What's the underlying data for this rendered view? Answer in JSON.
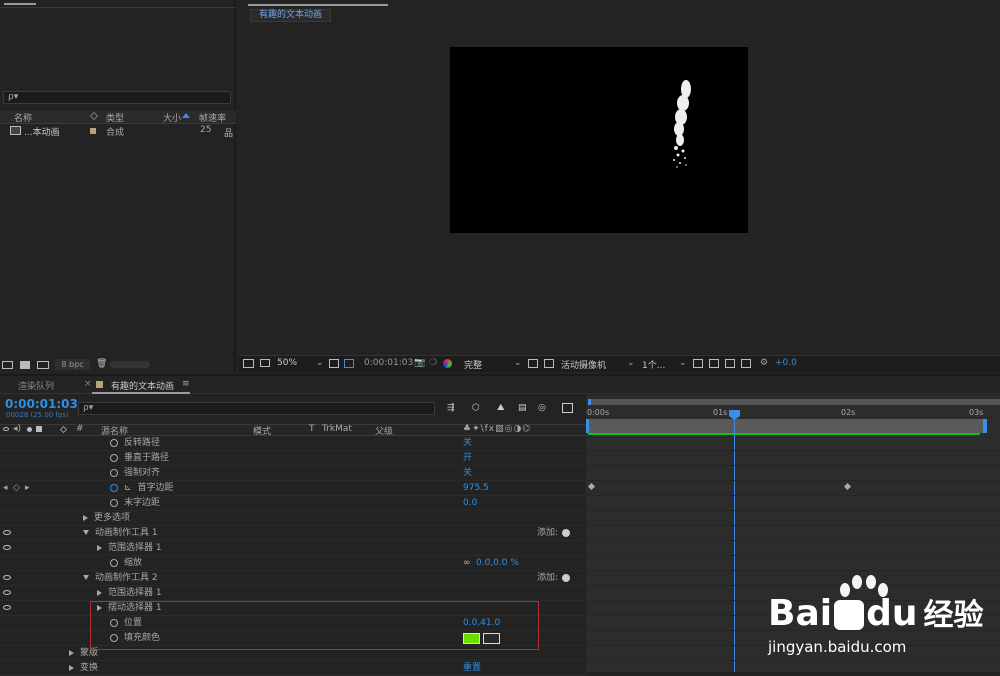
{
  "project": {
    "search_placeholder": "ρ▾",
    "columns": {
      "name": "名称",
      "type": "类型",
      "size": "大小",
      "fps": "帧速率"
    },
    "items": [
      {
        "name": "...本动画",
        "type": "合成",
        "fps": "25"
      }
    ],
    "bpc": "8 bpc"
  },
  "viewer": {
    "tab": "有趣的文本动画",
    "toolbar": {
      "zoom": "50%",
      "timecode": "0:00:01:03",
      "quality": "完整",
      "camera": "活动摄像机",
      "view": "1个...",
      "exposure": "+0.0"
    }
  },
  "timeline": {
    "tabs": {
      "render_queue": "渲染队列",
      "comp": "有趣的文本动画"
    },
    "timecode": "0:00:01:03",
    "frame_info": "00028 (25.00 fps)",
    "search_placeholder": "ρ▾",
    "header": {
      "hash": "#",
      "source_name": "源名称",
      "mode": "模式",
      "t": "T",
      "trkmat": "TrkMat",
      "parent": "父级"
    },
    "ruler": [
      "0:00s",
      "01s",
      "02s",
      "03s"
    ],
    "rows": [
      {
        "label": "反转路径",
        "value": "关"
      },
      {
        "label": "垂直于路径",
        "value": "开"
      },
      {
        "label": "强制对齐",
        "value": "关"
      },
      {
        "label": "首字边距",
        "value": "975.5"
      },
      {
        "label": "末字边距",
        "value": "0.0"
      },
      {
        "label": "更多选项"
      },
      {
        "label": "动画制作工具 1",
        "add": "添加:"
      },
      {
        "label": "范围选择器 1"
      },
      {
        "label": "缩放",
        "value": "0.0,0.0 %"
      },
      {
        "label": "动画制作工具 2",
        "add": "添加:"
      },
      {
        "label": "范围选择器 1"
      },
      {
        "label": "摆动选择器 1"
      },
      {
        "label": "位置",
        "value": "0.0,41.0"
      },
      {
        "label": "填充颜色"
      },
      {
        "label": "蒙版"
      },
      {
        "label": "变换",
        "value": "重置"
      }
    ],
    "fill_color": "#6ddc00"
  },
  "watermark": {
    "brand": "Bai",
    "brand2": "du",
    "cn": "经验",
    "url": "jingyan.baidu.com"
  },
  "colors": {
    "accent": "#2f8fe0",
    "highlight_box": "#b03030",
    "work_bar": "#15c015"
  }
}
